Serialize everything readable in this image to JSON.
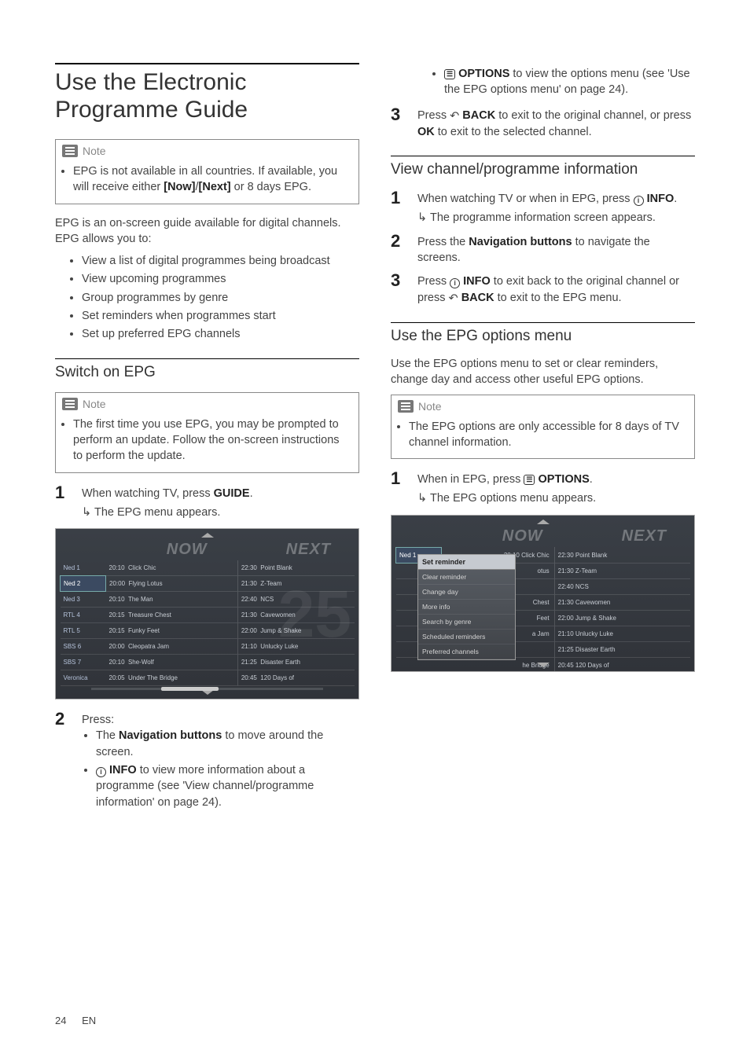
{
  "footer": {
    "page": "24",
    "lang": "EN"
  },
  "left": {
    "h1": "Use the Electronic Programme Guide",
    "note1": {
      "label": "Note",
      "text_pre": "EPG is not available in all countries. If available, you will receive either ",
      "bold1": "[Now]",
      "slash": "/",
      "bold2": "[Next]",
      "text_post": " or 8 days EPG."
    },
    "intro": "EPG is an on-screen guide available for digital channels. EPG allows you to:",
    "bullets": [
      "View a list of digital programmes being broadcast",
      "View upcoming programmes",
      "Group programmes by genre",
      "Set reminders when programmes start",
      "Set up preferred EPG channels"
    ],
    "h2a": "Switch on EPG",
    "note2": {
      "label": "Note",
      "text": "The first time you use EPG, you may be prompted to perform an update. Follow the on-screen instructions to perform the update."
    },
    "step1": {
      "pre": "When watching TV, press ",
      "bold": "GUIDE",
      "post": ".",
      "sub": "The EPG menu appears."
    },
    "screen1": {
      "now": "NOW",
      "next": "NEXT",
      "rows": [
        {
          "ch": "Ned 1",
          "t1": "20:10",
          "p1": "Click Chic",
          "t2": "22:30",
          "p2": "Point Blank"
        },
        {
          "ch": "Ned 2",
          "t1": "20:00",
          "p1": "Flying Lotus",
          "t2": "21:30",
          "p2": "Z-Team"
        },
        {
          "ch": "Ned 3",
          "t1": "20:10",
          "p1": "The Man",
          "t2": "22:40",
          "p2": "NCS"
        },
        {
          "ch": "RTL 4",
          "t1": "20:15",
          "p1": "Treasure Chest",
          "t2": "21:30",
          "p2": "Cavewomen"
        },
        {
          "ch": "RTL 5",
          "t1": "20:15",
          "p1": "Funky Feet",
          "t2": "22:00",
          "p2": "Jump & Shake"
        },
        {
          "ch": "SBS 6",
          "t1": "20:00",
          "p1": "Cleopatra Jam",
          "t2": "21:10",
          "p2": "Unlucky Luke"
        },
        {
          "ch": "SBS 7",
          "t1": "20:10",
          "p1": "She-Wolf",
          "t2": "21:25",
          "p2": "Disaster Earth"
        },
        {
          "ch": "Veronica",
          "t1": "20:05",
          "p1": "Under The Bridge",
          "t2": "20:45",
          "p2": "120 Days of"
        }
      ]
    },
    "step2": {
      "pre": "Press:",
      "b1_pre": "The ",
      "b1_bold": "Navigation buttons",
      "b1_post": " to move around the screen.",
      "b2_bold": "INFO",
      "b2_post": " to view more information about a programme (see 'View channel/programme information' on page 24)."
    }
  },
  "right": {
    "cont_b1_bold": "OPTIONS",
    "cont_b1_post": " to view the options menu (see 'Use the EPG options menu' on page 24).",
    "step3": {
      "pre": "Press ",
      "bold1": "BACK",
      "mid": " to exit to the original channel, or press ",
      "bold2": "OK",
      "post": " to exit to the selected channel."
    },
    "h2b": "View channel/programme information",
    "b_step1": {
      "pre": "When watching TV or when in EPG, press ",
      "bold": "INFO",
      "post": ".",
      "sub": "The programme information screen appears."
    },
    "b_step2": {
      "pre": "Press the ",
      "bold": "Navigation buttons",
      "post": " to navigate the screens."
    },
    "b_step3": {
      "pre": "Press ",
      "bold1": "INFO",
      "mid": " to exit back to the original channel or press ",
      "bold2": "BACK",
      "post": " to exit to the EPG menu."
    },
    "h2c": "Use the EPG options menu",
    "c_intro": "Use the EPG options menu to set or clear reminders, change day and access other useful EPG options.",
    "note3": {
      "label": "Note",
      "text": "The EPG options are only accessible for 8 days of TV channel information."
    },
    "c_step1": {
      "pre": "When in EPG, press ",
      "bold": "OPTIONS",
      "post": ".",
      "sub": "The EPG options menu appears."
    },
    "screen2": {
      "now": "NOW",
      "next": "NEXT",
      "rows": [
        {
          "ch": "Ned 1",
          "t1": "20:10 Click Chic",
          "t2": "22:30 Point Blank"
        },
        {
          "ch": "",
          "t1": "otus",
          "t2": "21:30 Z-Team"
        },
        {
          "ch": "",
          "t1": "",
          "t2": "22:40 NCS"
        },
        {
          "ch": "",
          "t1": "Chest",
          "t2": "21:30 Cavewomen"
        },
        {
          "ch": "",
          "t1": "Feet",
          "t2": "22:00 Jump & Shake"
        },
        {
          "ch": "",
          "t1": "a Jam",
          "t2": "21:10 Unlucky Luke"
        },
        {
          "ch": "",
          "t1": "",
          "t2": "21:25 Disaster Earth"
        },
        {
          "ch": "",
          "t1": "he Bridge",
          "t2": "20:45 120 Days of"
        }
      ],
      "menu": [
        "Set reminder",
        "Clear reminder",
        "Change day",
        "More info",
        "Search by genre",
        "Scheduled reminders",
        "Preferred channels"
      ]
    }
  }
}
